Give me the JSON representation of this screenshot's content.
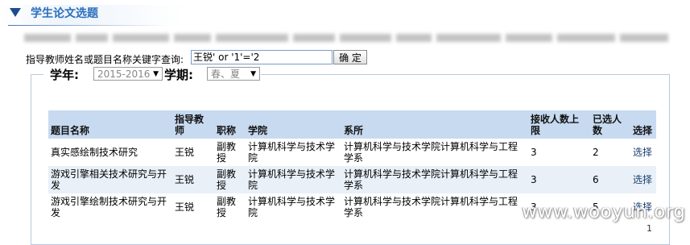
{
  "header": {
    "title": "学生论文选题"
  },
  "search": {
    "label": "指导教师姓名或题目名称关键字查询:",
    "value": "王锐' or '1'='2",
    "button_label": "确 定"
  },
  "filters": {
    "year_label": "学年:",
    "year_value": "2015-2016",
    "term_label": "学期:",
    "term_value": "春、夏"
  },
  "table": {
    "columns": [
      "题目名称",
      "指导教师",
      "职称",
      "学院",
      "系所",
      "接收人数上限",
      "已选人数",
      "选择"
    ],
    "rows": [
      [
        "真实感绘制技术研究",
        "王锐",
        "副教授",
        "计算机科学与技术学院",
        "计算机科学与技术学院计算机科学与工程学系",
        "3",
        "2",
        "选择"
      ],
      [
        "游戏引擎相关技术研究与开发",
        "王锐",
        "副教授",
        "计算机科学与技术学院",
        "计算机科学与技术学院计算机科学与工程学系",
        "3",
        "6",
        "选择"
      ],
      [
        "游戏引擎绘制技术研究与开发",
        "王锐",
        "副教授",
        "计算机科学与技术学院",
        "计算机科学与技术学院计算机科学与工程学系",
        "3",
        "5",
        "选择"
      ]
    ]
  },
  "watermark": "www.wooyun.org",
  "pager": {
    "page": "1"
  },
  "colors": {
    "header_bg": "#c7daf0",
    "title": "#2a6fbd",
    "accent": "#1c4b8f"
  }
}
